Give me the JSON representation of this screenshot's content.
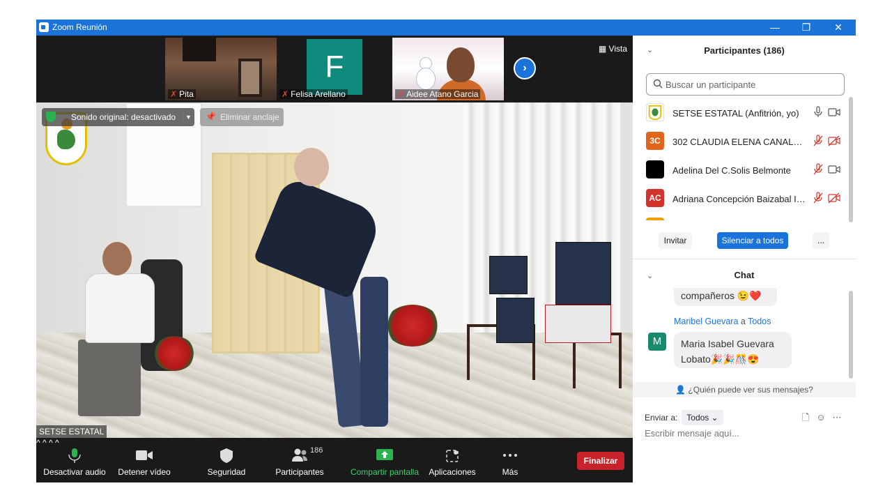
{
  "window": {
    "title": "Zoom Reunión",
    "minimize": "—",
    "restore": "❐",
    "close": "✕"
  },
  "strip": {
    "tiles": [
      {
        "name": "Pita"
      },
      {
        "name": "Felisa Arellano",
        "initial": "F"
      },
      {
        "name": "Aidee Atano Garcia"
      }
    ],
    "view_label": "Vista"
  },
  "main_video": {
    "sound_original": "Sonido original: desactivado",
    "unpin_label": "Eliminar anclaje",
    "speaker_name": "SETSE ESTATAL"
  },
  "toolbar": {
    "audio_label": "Desactivar audio",
    "video_label": "Detener vídeo",
    "security_label": "Seguridad",
    "participants_label": "Participantes",
    "participants_count": "186",
    "share_label": "Compartir pantalla",
    "apps_label": "Aplicaciones",
    "more_label": "Más",
    "end_label": "Finalizar"
  },
  "participants": {
    "title": "Participantes (186)",
    "search_placeholder": "Buscar un participante",
    "items": [
      {
        "name": "SETSE ESTATAL (Anfitrión, yo)",
        "initials": "",
        "color": "#ffffff",
        "mic": "on",
        "cam": "on"
      },
      {
        "name": "302 CLAUDIA ELENA CANALES ...",
        "initials": "3C",
        "color": "#e0641c",
        "mic": "off",
        "cam": "off"
      },
      {
        "name": "Adelina Del C.Solis Belmonte",
        "initials": "",
        "color": "#000000",
        "mic": "off",
        "cam": "on"
      },
      {
        "name": "Adriana Concepción Baizabal Ib...",
        "initials": "AC",
        "color": "#d0342c",
        "mic": "off",
        "cam": "off"
      }
    ],
    "invite_label": "Invitar",
    "mute_all_label": "Silenciar a todos",
    "more_label": "..."
  },
  "chat": {
    "title": "Chat",
    "prev_message_tail": "compañeros 😉❤️",
    "sender": "Maribel Guevara",
    "to_word": "a",
    "recipient": "Todos",
    "sender_initial": "M",
    "message_line1": "Maria Isabel Guevara",
    "message_line2": "Lobato🎉🎉🎊😍",
    "who_sees": "¿Quién puede ver sus mensajes?",
    "send_to_label": "Enviar a:",
    "send_to_value": "Todos",
    "compose_placeholder": "Escribir mensaje aquí..."
  }
}
